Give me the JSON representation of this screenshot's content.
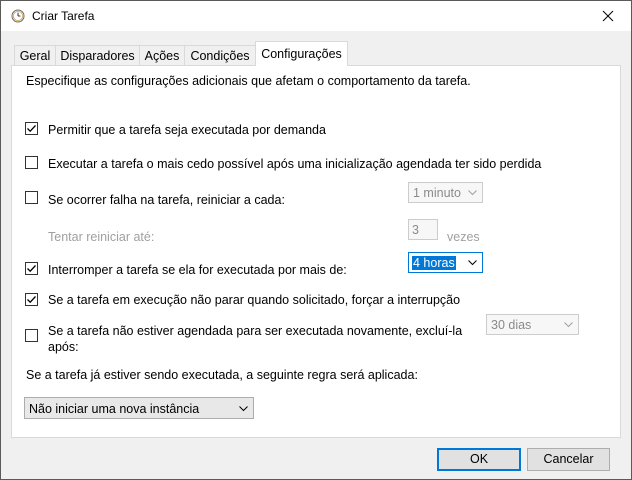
{
  "window": {
    "title": "Criar Tarefa"
  },
  "tabs": [
    {
      "label": "Geral"
    },
    {
      "label": "Disparadores"
    },
    {
      "label": "Ações"
    },
    {
      "label": "Condições"
    },
    {
      "label": "Configurações",
      "active": true
    }
  ],
  "settings": {
    "description": "Especifique as configurações adicionais que afetam o comportamento da tarefa.",
    "allow_on_demand": {
      "label": "Permitir que a tarefa seja executada por demanda",
      "checked": true
    },
    "run_asap": {
      "label": "Executar a tarefa o mais cedo possível após uma inicialização agendada ter sido perdida",
      "checked": false
    },
    "restart_on_fail": {
      "label": "Se ocorrer falha na tarefa, reiniciar a cada:",
      "checked": false,
      "interval": "1 minuto"
    },
    "restart_attempts": {
      "label": "Tentar reiniciar até:",
      "value": "3",
      "unit": "vezes"
    },
    "stop_if_longer": {
      "label": "Interromper a tarefa se ela for executada por mais de:",
      "checked": true,
      "duration": "4 horas"
    },
    "force_stop": {
      "label": "Se a tarefa em execução não parar quando solicitado, forçar a interrupção",
      "checked": true
    },
    "delete_if_not_scheduled": {
      "label_line1": "Se a tarefa não estiver agendada para ser executada novamente, excluí-la",
      "label_line2": "após:",
      "checked": false,
      "after": "30 dias"
    },
    "running_rule_label": "Se a tarefa já estiver sendo executada, a seguinte regra será aplicada:",
    "running_rule_value": "Não iniciar uma nova instância"
  },
  "buttons": {
    "ok": "OK",
    "cancel": "Cancelar"
  },
  "colors": {
    "accent": "#0078d7",
    "window_bg": "#f0f0f0",
    "panel_bg": "#ffffff",
    "disabled_text": "#a0a0a0"
  }
}
